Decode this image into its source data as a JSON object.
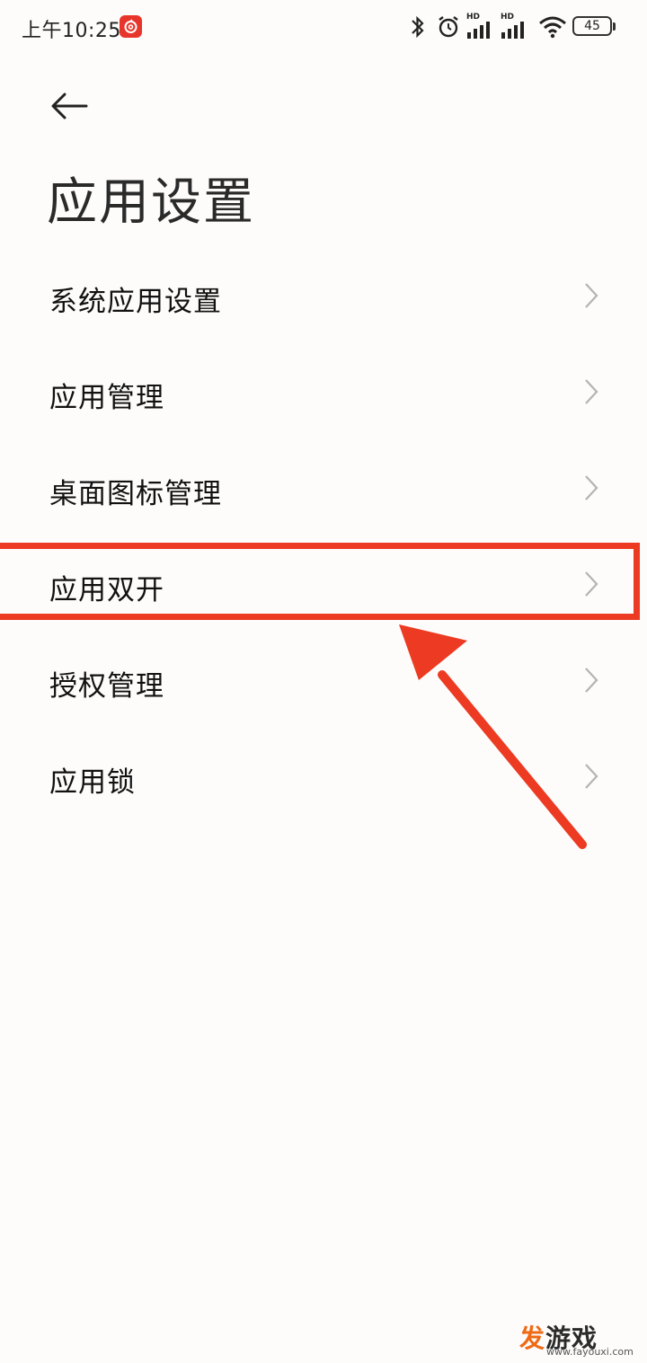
{
  "status_bar": {
    "time": "上午10:25",
    "battery": "45",
    "signal_label_1": "HD",
    "signal_label_2": "HD",
    "icons": [
      "netease-music-icon",
      "bluetooth-icon",
      "alarm-icon",
      "signal-hd-icon",
      "signal-hd-icon",
      "wifi-icon",
      "battery-icon"
    ]
  },
  "header": {
    "back_icon": "back-arrow-icon",
    "title": "应用设置"
  },
  "settings": {
    "items": [
      {
        "label": "系统应用设置"
      },
      {
        "label": "应用管理"
      },
      {
        "label": "桌面图标管理"
      },
      {
        "label": "应用双开"
      },
      {
        "label": "授权管理"
      },
      {
        "label": "应用锁"
      }
    ]
  },
  "annotation": {
    "highlight_color": "#ec3b22",
    "highlighted_item": "应用双开"
  },
  "watermark": {
    "brand_first": "发",
    "brand_rest": "游戏",
    "url": "www.fayouxi.com"
  }
}
